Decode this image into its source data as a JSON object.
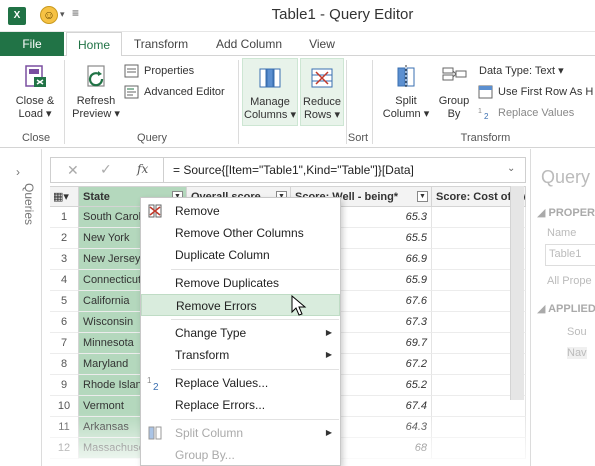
{
  "window": {
    "title": "Table1 - Query Editor"
  },
  "quick_access": {
    "logo_text": "X"
  },
  "tabs": [
    {
      "label": "File"
    },
    {
      "label": "Home"
    },
    {
      "label": "Transform"
    },
    {
      "label": "Add Column"
    },
    {
      "label": "View"
    }
  ],
  "ribbon": {
    "close_load": "Close &",
    "close_load2": "Load ▾",
    "refresh": "Refresh",
    "refresh2": "Preview ▾",
    "properties": "Properties",
    "advanced_editor": "Advanced Editor",
    "manage_columns": "Manage",
    "manage_columns2": "Columns ▾",
    "reduce_rows": "Reduce",
    "reduce_rows2": "Rows ▾",
    "split_column": "Split",
    "split_column2": "Column ▾",
    "group_by": "Group",
    "group_by2": "By",
    "data_type": "Data Type: Text ▾",
    "use_first_row": "Use First Row As H",
    "replace_values": "Replace Values",
    "groups": {
      "close": "Close",
      "query": "Query",
      "sort": "Sort",
      "transform": "Transform"
    }
  },
  "left_strip": {
    "label": "Queries",
    "chevron": "›"
  },
  "formula_bar": {
    "cancel_icon": "✕",
    "confirm_icon": "✓",
    "fx": "fx",
    "formula": "= Source{[Item=\"Table1\",Kind=\"Table\"]}[Data]",
    "expand": "⌄"
  },
  "grid": {
    "corner": "▦▾",
    "columns": [
      {
        "label": "State"
      },
      {
        "label": "Overall score"
      },
      {
        "label": "Score: Well - being*"
      },
      {
        "label": "Score: Cost of living"
      }
    ],
    "filter_glyph": "▼",
    "rows": [
      {
        "n": "1",
        "state": "South Carolina",
        "wellbeing": "65.3"
      },
      {
        "n": "2",
        "state": "New York",
        "wellbeing": "65.5"
      },
      {
        "n": "3",
        "state": "New Jersey",
        "wellbeing": "66.9"
      },
      {
        "n": "4",
        "state": "Connecticut",
        "wellbeing": "65.9"
      },
      {
        "n": "5",
        "state": "California",
        "wellbeing": "67.6"
      },
      {
        "n": "6",
        "state": "Wisconsin",
        "wellbeing": "67.3"
      },
      {
        "n": "7",
        "state": "Minnesota",
        "wellbeing": "69.7"
      },
      {
        "n": "8",
        "state": "Maryland",
        "wellbeing": "67.2"
      },
      {
        "n": "9",
        "state": "Rhode Island",
        "wellbeing": "65.2"
      },
      {
        "n": "10",
        "state": "Vermont",
        "wellbeing": "67.4"
      },
      {
        "n": "11",
        "state": "Arkansas",
        "wellbeing": "64.3"
      },
      {
        "n": "12",
        "state": "Massachusetts",
        "wellbeing": "68"
      }
    ]
  },
  "right_pane": {
    "title": "Query",
    "properties": "◢ PROPER",
    "name_label": "Name",
    "name_value": "Table1",
    "all_properties": "All Prope",
    "applied_steps": "◢ APPLIED",
    "step1": "Sou",
    "step2": "Nav"
  },
  "context_menu": {
    "items": [
      {
        "label": "Remove"
      },
      {
        "label": "Remove Other Columns"
      },
      {
        "label": "Duplicate Column"
      },
      {
        "label": "Remove Duplicates"
      },
      {
        "label": "Remove Errors"
      },
      {
        "label": "Change Type"
      },
      {
        "label": "Transform"
      },
      {
        "label": "Replace Values..."
      },
      {
        "label": "Replace Errors..."
      },
      {
        "label": "Split Column"
      },
      {
        "label": "Group By..."
      }
    ],
    "submenu_arrow": "▶"
  },
  "colors": {
    "accent": "#217346",
    "selection": "#b4d8bd",
    "hover": "#d9ecdd"
  }
}
